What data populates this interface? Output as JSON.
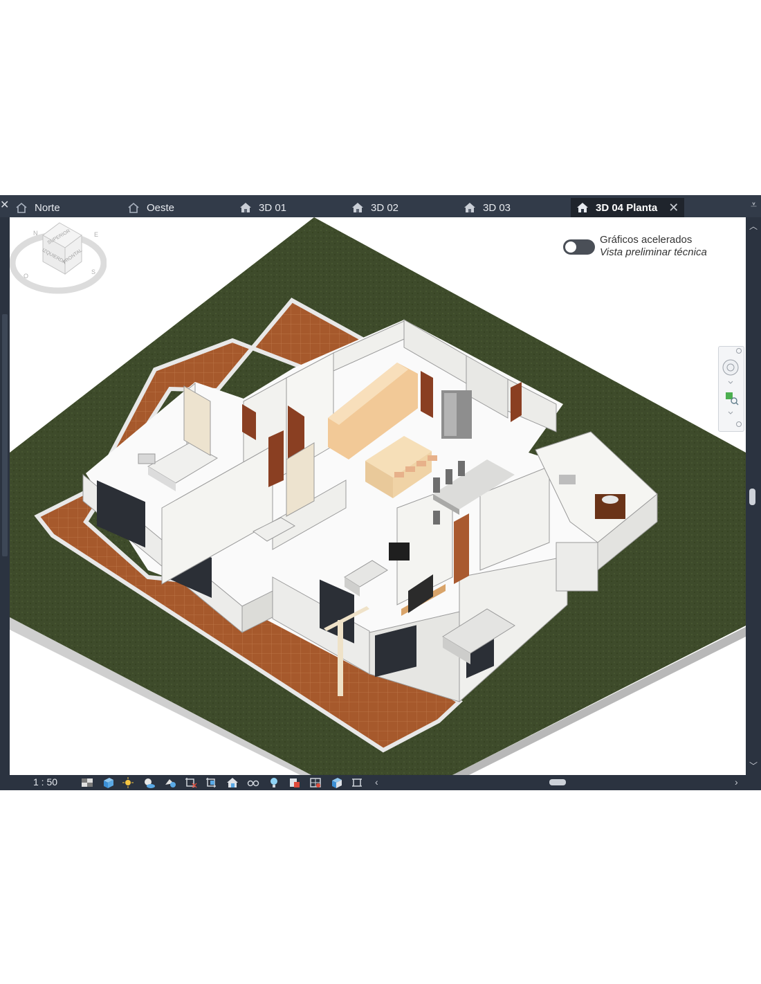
{
  "tabs": [
    {
      "label": "Norte",
      "icon": "elevation-view-icon"
    },
    {
      "label": "Oeste",
      "icon": "elevation-view-icon"
    },
    {
      "label": "3D 01",
      "icon": "3d-view-house-icon"
    },
    {
      "label": "3D 02",
      "icon": "3d-view-house-icon"
    },
    {
      "label": "3D 03",
      "icon": "3d-view-house-icon"
    },
    {
      "label": "3D 04 Planta",
      "icon": "3d-view-house-icon",
      "active": true
    }
  ],
  "graphics": {
    "title": "Gráficos acelerados",
    "subtitle": "Vista preliminar técnica",
    "enabled": false
  },
  "viewcube": {
    "faces": [
      "SUPERIOR",
      "IZQUIERDA",
      "FRONTAL"
    ],
    "compass": [
      "N",
      "O",
      "S",
      "E"
    ]
  },
  "statusbar": {
    "scale": "1 : 50",
    "icons": [
      "detail-level-icon",
      "visual-style-icon",
      "sun-path-icon",
      "shadows-icon",
      "render-icon",
      "crop-view-icon",
      "hide-crop-icon",
      "unlock-3d-icon",
      "temporary-hide-icon",
      "reveal-hidden-icon",
      "temporary-view-properties-icon",
      "worksharing-icon",
      "analytical-model-icon",
      "highlight-displacement-icon",
      "reveal-constraints-icon"
    ]
  },
  "colors": {
    "grass": "#3d4a2a",
    "deck": "#a55a2e",
    "walls": "#f2f2ef",
    "floor": "#fafafa",
    "ui_dark": "#2b3340"
  }
}
